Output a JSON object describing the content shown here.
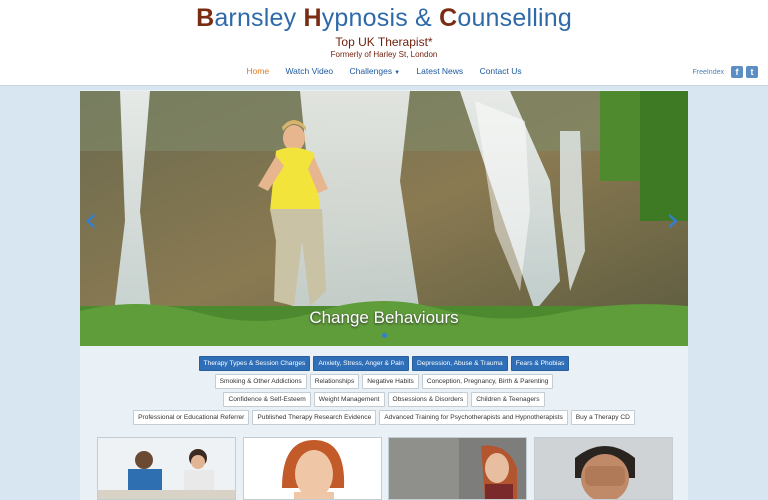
{
  "header": {
    "title_parts": [
      {
        "cap": "B",
        "rest": "arnsley "
      },
      {
        "cap": "H",
        "rest": "ypnosis & "
      },
      {
        "cap": "C",
        "rest": "ounselling"
      }
    ],
    "tagline": "Top UK Therapist*",
    "subtagline": "Formerly of Harley St, London"
  },
  "nav": {
    "items": [
      {
        "label": "Home",
        "active": true
      },
      {
        "label": "Watch Video"
      },
      {
        "label": "Challenges"
      },
      {
        "label": "Latest News"
      },
      {
        "label": "Contact Us"
      }
    ]
  },
  "social": {
    "freeindex": "FreeIndex",
    "facebook_glyph": "f",
    "twitter_glyph": "t"
  },
  "slider": {
    "caption": "Change Behaviours",
    "prev_glyph": "‹",
    "next_glyph": "›"
  },
  "tags": {
    "rows": [
      [
        "Therapy Types & Session Charges",
        "Anxiety, Stress, Anger & Pain",
        "Depression, Abuse & Trauma",
        "Fears & Phobias"
      ],
      [
        "Smoking & Other Addictions",
        "Relationships",
        "Negative Habits",
        "Conception, Pregnancy, Birth & Parenting"
      ],
      [
        "Confidence & Self-Esteem",
        "Weight Management",
        "Obsessions & Disorders",
        "Children & Teenagers"
      ],
      [
        "Professional or Educational Referrer",
        "Published Therapy Research Evidence",
        "Advanced Training for Psychotherapists and Hypnotherapists",
        "Buy a Therapy CD"
      ]
    ]
  },
  "colors": {
    "brand_blue": "#2e6aa8",
    "brand_brown": "#7a2b12",
    "nav_active": "#e07a1f",
    "tag_primary": "#2e6fb8"
  }
}
